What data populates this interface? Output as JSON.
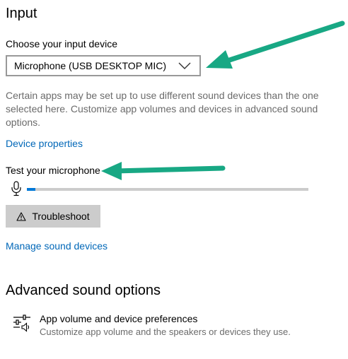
{
  "input": {
    "title": "Input",
    "choose_label": "Choose your input device",
    "device_value": "Microphone (USB DESKTOP MIC)",
    "description": "Certain apps may be set up to use different sound devices than the one selected here. Customize app volumes and devices in advanced sound options.",
    "device_properties_link": "Device properties",
    "test_label": "Test your microphone",
    "mic_level": 0.03,
    "troubleshoot_label": "Troubleshoot",
    "manage_link": "Manage sound devices"
  },
  "advanced": {
    "title": "Advanced sound options",
    "pref_title": "App volume and device preferences",
    "pref_subtitle": "Customize app volume and the speakers or devices they use."
  },
  "colors": {
    "accent": "#0078d7",
    "link": "#0067b8",
    "annotation_arrow": "#18a884"
  },
  "icons": {
    "chevron": "chevron-down-icon",
    "microphone": "microphone-icon",
    "warning": "warning-icon",
    "preferences": "app-volume-preferences-icon"
  }
}
